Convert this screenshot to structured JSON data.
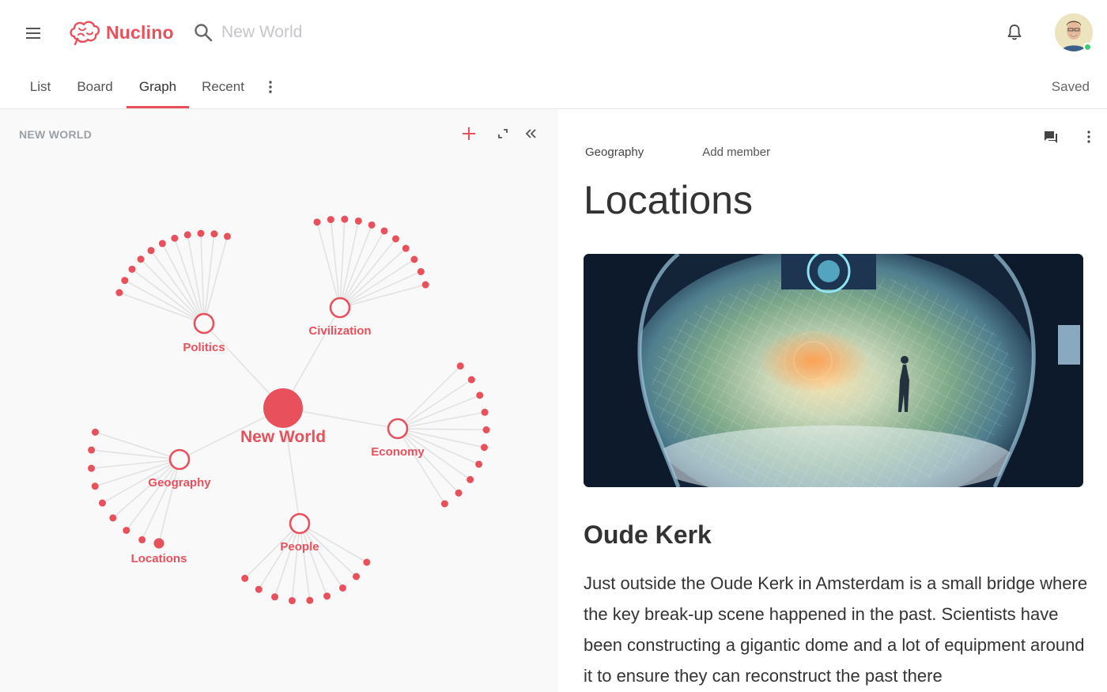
{
  "header": {
    "app_name": "Nuclino",
    "search_text": "New World",
    "icons": [
      "hamburger-menu-icon",
      "brain-logo-icon",
      "search-icon",
      "bell-icon"
    ]
  },
  "tabs": {
    "items": [
      {
        "label": "List"
      },
      {
        "label": "Board"
      },
      {
        "label": "Graph",
        "active": true
      },
      {
        "label": "Recent"
      }
    ],
    "status": "Saved"
  },
  "graph_panel": {
    "title": "NEW WORLD",
    "root": "New World",
    "hubs": [
      {
        "label": "Politics",
        "leaves": 11
      },
      {
        "label": "Civilization",
        "leaves": 11
      },
      {
        "label": "Economy",
        "leaves": 10
      },
      {
        "label": "Geography",
        "leaves": 8
      },
      {
        "label": "People",
        "leaves": 9
      }
    ],
    "extra_node": "Locations",
    "colors": {
      "accent": "#e8505b",
      "edge": "#e2e2e2"
    }
  },
  "document": {
    "breadcrumb": "Geography",
    "add_member": "Add member",
    "title": "Locations",
    "section_heading": "Oude Kerk",
    "paragraph": "Just outside the Oude Kerk in Amsterdam is a small bridge where the key break-up scene happened in the past. Scientists have been constructing a gigantic dome and a lot of equipment around it to ensure they can reconstruct the past there"
  }
}
